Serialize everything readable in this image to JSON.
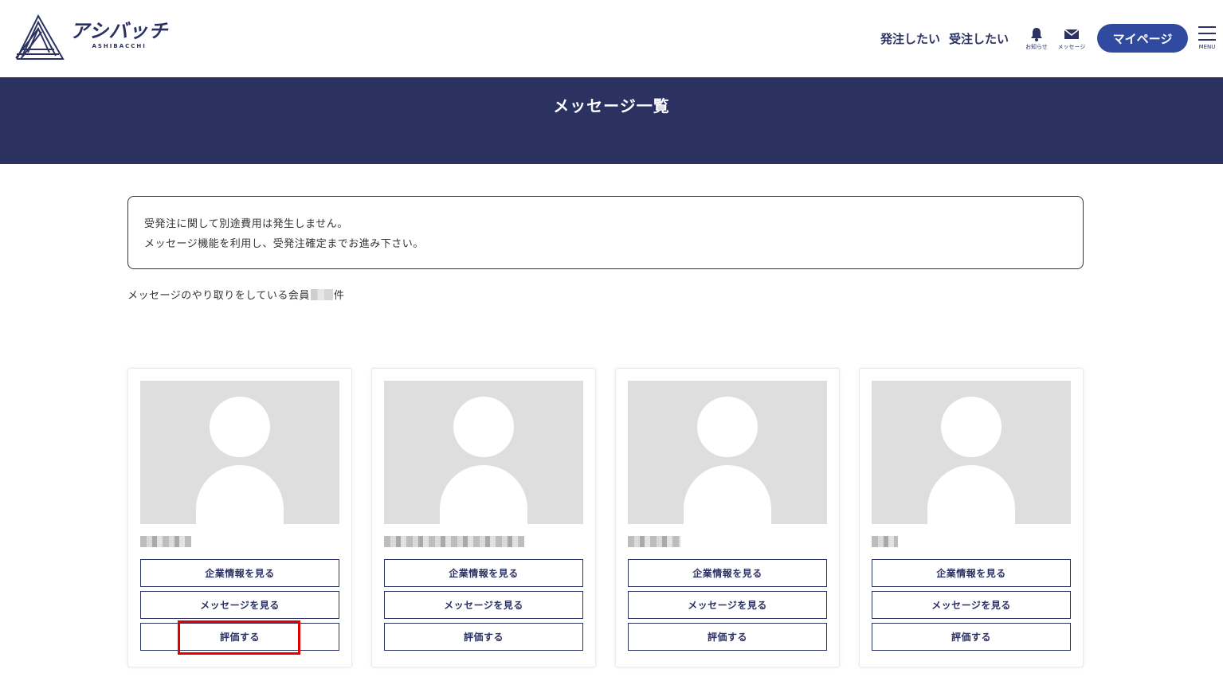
{
  "header": {
    "logo_jp": "アシバッチ",
    "logo_en": "ASHIBACCHI",
    "nav": {
      "order_label": "発注したい",
      "receive_label": "受注したい",
      "notifications_label": "お知らせ",
      "messages_label": "メッセージ",
      "mypage_label": "マイページ",
      "menu_label": "MENU"
    }
  },
  "page": {
    "title": "メッセージ一覧",
    "notice_lines": [
      "受発注に関して別途費用は発生しません。",
      "メッセージ機能を利用し、受発注確定までお進み下さい。"
    ],
    "count_prefix": "メッセージのやり取りをしている会員",
    "count_suffix": "件"
  },
  "cards": [
    {
      "view_company": "企業情報を見る",
      "view_messages": "メッセージを見る",
      "rate": "評価する",
      "highlighted": true
    },
    {
      "view_company": "企業情報を見る",
      "view_messages": "メッセージを見る",
      "rate": "評価する",
      "highlighted": false
    },
    {
      "view_company": "企業情報を見る",
      "view_messages": "メッセージを見る",
      "rate": "評価する",
      "highlighted": false
    },
    {
      "view_company": "企業情報を見る",
      "view_messages": "メッセージを見る",
      "rate": "評価する",
      "highlighted": false
    }
  ],
  "colors": {
    "navy": "#2b3262",
    "primary_button": "#2f4a9e",
    "highlight": "#e00000",
    "avatar_bg": "#dedede"
  },
  "icons": {
    "notifications": "bell-icon",
    "messages": "envelope-icon",
    "menu": "hamburger-icon",
    "avatar": "user-silhouette-icon"
  }
}
